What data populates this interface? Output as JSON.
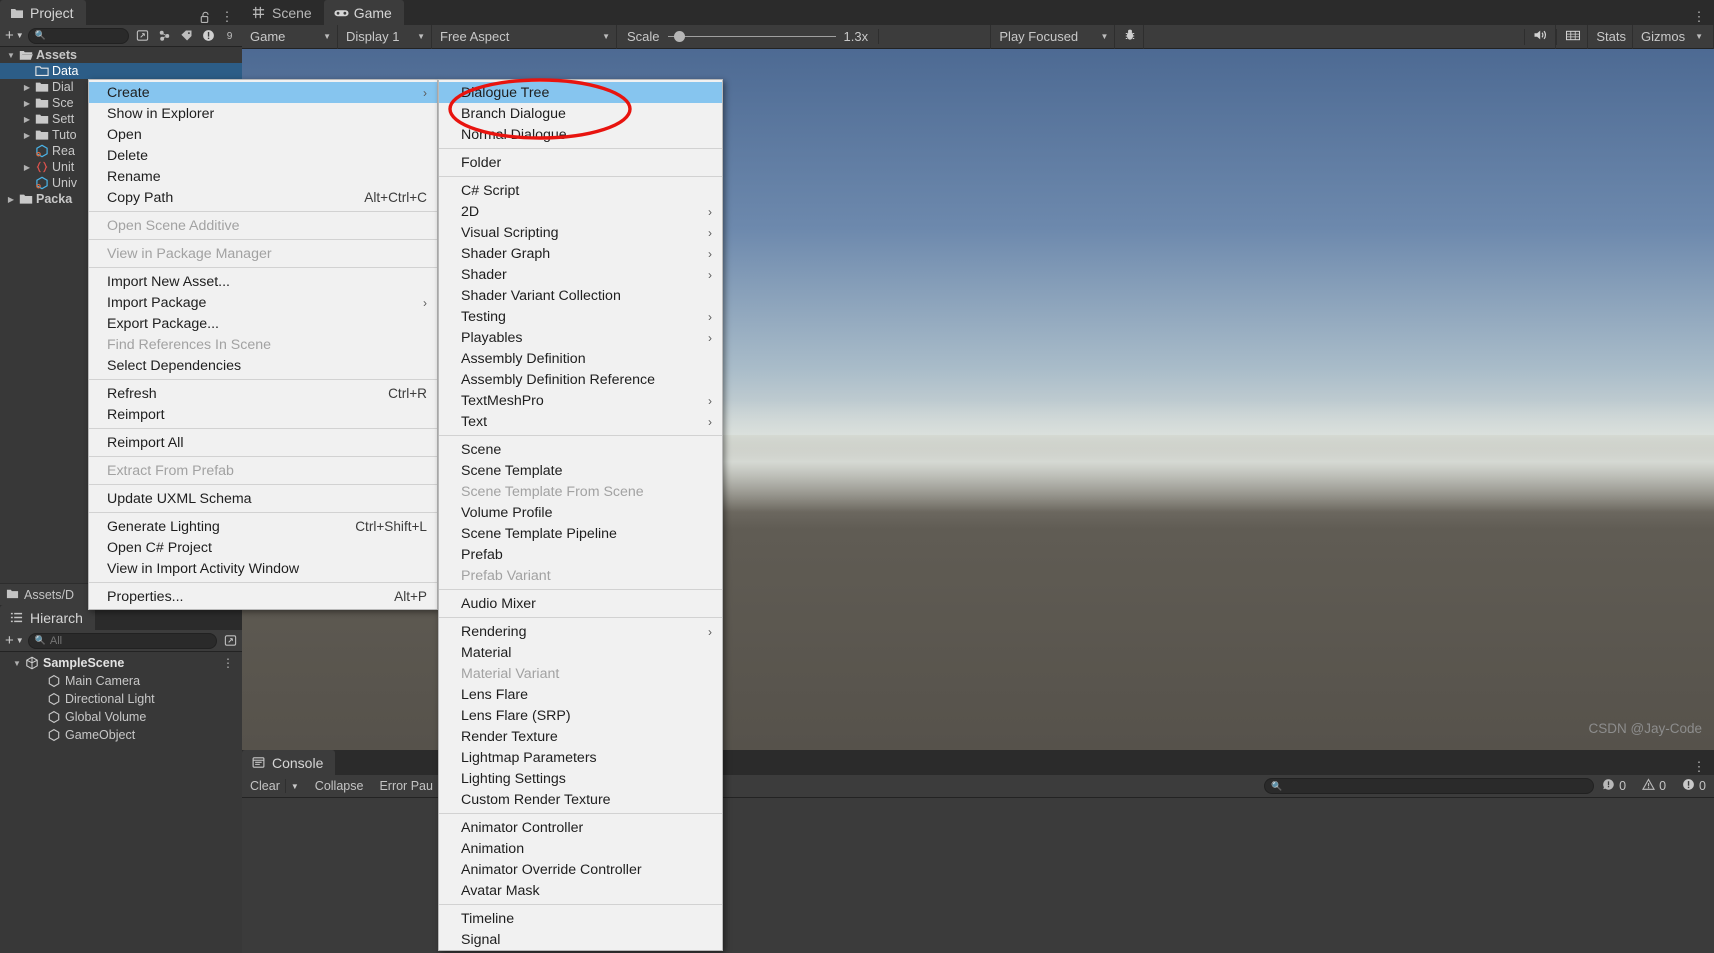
{
  "project_panel": {
    "tab_label": "Project",
    "tab_icon": "folder-icon",
    "lock_icon": "lock-open-icon",
    "kebab_icon": "more-vertical-icon",
    "toolbar": {
      "create_label": "+",
      "search_placeholder": "",
      "search_value": "",
      "search_icon": "search-icon",
      "icons": [
        "favorites-icon",
        "label-icon",
        "info-icon",
        "hidden-icon"
      ]
    },
    "tree": [
      {
        "label": "Assets",
        "icon": "open-folder-icon",
        "indent": 0,
        "twisty": "down",
        "selected": false,
        "bold": true
      },
      {
        "label": "Data",
        "icon": "folder-outline-icon",
        "indent": 1,
        "twisty": "none",
        "selected": true,
        "bold": false
      },
      {
        "label": "Dial",
        "icon": "folder-icon",
        "indent": 1,
        "twisty": "right",
        "selected": false,
        "bold": false
      },
      {
        "label": "Sce",
        "icon": "folder-icon",
        "indent": 1,
        "twisty": "right",
        "selected": false,
        "bold": false
      },
      {
        "label": "Sett",
        "icon": "folder-icon",
        "indent": 1,
        "twisty": "right",
        "selected": false,
        "bold": false
      },
      {
        "label": "Tuto",
        "icon": "folder-icon",
        "indent": 1,
        "twisty": "right",
        "selected": false,
        "bold": false
      },
      {
        "label": "Rea",
        "icon": "prefab-icon",
        "indent": 1,
        "twisty": "none",
        "selected": false,
        "bold": false
      },
      {
        "label": "Unit",
        "icon": "json-icon",
        "indent": 1,
        "twisty": "right",
        "selected": false,
        "bold": false
      },
      {
        "label": "Univ",
        "icon": "prefab-icon",
        "indent": 1,
        "twisty": "none",
        "selected": false,
        "bold": false
      },
      {
        "label": "Packa",
        "icon": "folder-icon",
        "indent": 0,
        "twisty": "right",
        "selected": false,
        "bold": true
      }
    ],
    "path_bar": {
      "label": "Assets/D",
      "icon": "folder-icon"
    }
  },
  "hierarchy_panel": {
    "tab_label": "Hierarch",
    "tab_icon": "hierarchy-icon",
    "toolbar": {
      "create_label": "+",
      "search_placeholder": "All",
      "search_icon": "search-icon"
    },
    "tree": [
      {
        "label": "SampleScene",
        "icon": "scene-icon",
        "indent": 0,
        "twisty": "down",
        "kebab": true
      },
      {
        "label": "Main Camera",
        "icon": "gameobject-icon",
        "indent": 1,
        "twisty": "none",
        "kebab": false
      },
      {
        "label": "Directional Light",
        "icon": "gameobject-icon",
        "indent": 1,
        "twisty": "none",
        "kebab": false
      },
      {
        "label": "Global Volume",
        "icon": "gameobject-icon",
        "indent": 1,
        "twisty": "none",
        "kebab": false
      },
      {
        "label": "GameObject",
        "icon": "gameobject-icon",
        "indent": 1,
        "twisty": "none",
        "kebab": false
      }
    ]
  },
  "game_panel": {
    "tabs": [
      {
        "label": "Scene",
        "icon": "scene-grid-icon",
        "active": false
      },
      {
        "label": "Game",
        "icon": "gamepad-icon",
        "active": true
      }
    ],
    "kebab_icon": "more-vertical-icon",
    "toolbar": {
      "target_display": "Game",
      "display": "Display 1",
      "aspect": "Free Aspect",
      "scale_label": "Scale",
      "scale_value": "1.3x",
      "scale_percent": 4,
      "play_mode": "Play Focused",
      "bug_icon": "bug-icon",
      "mute_icon": "mute-audio-icon",
      "grid_icon": "stats-grid-icon",
      "stats_label": "Stats",
      "gizmos_label": "Gizmos",
      "gizmos_caret": "chevron-down-icon"
    }
  },
  "console_panel": {
    "tab_label": "Console",
    "tab_icon": "console-icon",
    "toolbar": {
      "clear_label": "Clear",
      "clear_caret": "chevron-down-icon",
      "collapse_label": "Collapse",
      "error_pause_label": "Error Pau",
      "search_placeholder": "",
      "search_icon": "search-icon",
      "counts": [
        {
          "icon": "log-icon",
          "value": "0"
        },
        {
          "icon": "warning-icon",
          "value": "0"
        },
        {
          "icon": "error-icon",
          "value": "0"
        }
      ],
      "kebab_icon": "more-vertical-icon"
    }
  },
  "context_menu": {
    "items": [
      {
        "label": "Create",
        "shortcut": "",
        "submenu": true,
        "disabled": false,
        "highlight": true
      },
      {
        "label": "Show in Explorer",
        "shortcut": "",
        "submenu": false,
        "disabled": false,
        "highlight": false
      },
      {
        "label": "Open",
        "shortcut": "",
        "submenu": false,
        "disabled": false,
        "highlight": false
      },
      {
        "label": "Delete",
        "shortcut": "",
        "submenu": false,
        "disabled": false,
        "highlight": false
      },
      {
        "label": "Rename",
        "shortcut": "",
        "submenu": false,
        "disabled": false,
        "highlight": false
      },
      {
        "label": "Copy Path",
        "shortcut": "Alt+Ctrl+C",
        "submenu": false,
        "disabled": false,
        "highlight": false
      },
      {
        "separator": true
      },
      {
        "label": "Open Scene Additive",
        "shortcut": "",
        "submenu": false,
        "disabled": true,
        "highlight": false
      },
      {
        "separator": true
      },
      {
        "label": "View in Package Manager",
        "shortcut": "",
        "submenu": false,
        "disabled": true,
        "highlight": false
      },
      {
        "separator": true
      },
      {
        "label": "Import New Asset...",
        "shortcut": "",
        "submenu": false,
        "disabled": false,
        "highlight": false
      },
      {
        "label": "Import Package",
        "shortcut": "",
        "submenu": true,
        "disabled": false,
        "highlight": false
      },
      {
        "label": "Export Package...",
        "shortcut": "",
        "submenu": false,
        "disabled": false,
        "highlight": false
      },
      {
        "label": "Find References In Scene",
        "shortcut": "",
        "submenu": false,
        "disabled": true,
        "highlight": false
      },
      {
        "label": "Select Dependencies",
        "shortcut": "",
        "submenu": false,
        "disabled": false,
        "highlight": false
      },
      {
        "separator": true
      },
      {
        "label": "Refresh",
        "shortcut": "Ctrl+R",
        "submenu": false,
        "disabled": false,
        "highlight": false
      },
      {
        "label": "Reimport",
        "shortcut": "",
        "submenu": false,
        "disabled": false,
        "highlight": false
      },
      {
        "separator": true
      },
      {
        "label": "Reimport All",
        "shortcut": "",
        "submenu": false,
        "disabled": false,
        "highlight": false
      },
      {
        "separator": true
      },
      {
        "label": "Extract From Prefab",
        "shortcut": "",
        "submenu": false,
        "disabled": true,
        "highlight": false
      },
      {
        "separator": true
      },
      {
        "label": "Update UXML Schema",
        "shortcut": "",
        "submenu": false,
        "disabled": false,
        "highlight": false
      },
      {
        "separator": true
      },
      {
        "label": "Generate Lighting",
        "shortcut": "Ctrl+Shift+L",
        "submenu": false,
        "disabled": false,
        "highlight": false
      },
      {
        "label": "Open C# Project",
        "shortcut": "",
        "submenu": false,
        "disabled": false,
        "highlight": false
      },
      {
        "label": "View in Import Activity Window",
        "shortcut": "",
        "submenu": false,
        "disabled": false,
        "highlight": false
      },
      {
        "separator": true
      },
      {
        "label": "Properties...",
        "shortcut": "Alt+P",
        "submenu": false,
        "disabled": false,
        "highlight": false
      }
    ]
  },
  "create_submenu": {
    "items": [
      {
        "label": "Dialogue Tree",
        "submenu": false,
        "disabled": false,
        "highlight": true
      },
      {
        "label": "Branch Dialogue",
        "submenu": false,
        "disabled": false,
        "highlight": false
      },
      {
        "label": "Normal Dialogue",
        "submenu": false,
        "disabled": false,
        "highlight": false
      },
      {
        "separator": true
      },
      {
        "label": "Folder",
        "submenu": false,
        "disabled": false,
        "highlight": false
      },
      {
        "separator": true
      },
      {
        "label": "C# Script",
        "submenu": false,
        "disabled": false,
        "highlight": false
      },
      {
        "label": "2D",
        "submenu": true,
        "disabled": false,
        "highlight": false
      },
      {
        "label": "Visual Scripting",
        "submenu": true,
        "disabled": false,
        "highlight": false
      },
      {
        "label": "Shader Graph",
        "submenu": true,
        "disabled": false,
        "highlight": false
      },
      {
        "label": "Shader",
        "submenu": true,
        "disabled": false,
        "highlight": false
      },
      {
        "label": "Shader Variant Collection",
        "submenu": false,
        "disabled": false,
        "highlight": false
      },
      {
        "label": "Testing",
        "submenu": true,
        "disabled": false,
        "highlight": false
      },
      {
        "label": "Playables",
        "submenu": true,
        "disabled": false,
        "highlight": false
      },
      {
        "label": "Assembly Definition",
        "submenu": false,
        "disabled": false,
        "highlight": false
      },
      {
        "label": "Assembly Definition Reference",
        "submenu": false,
        "disabled": false,
        "highlight": false
      },
      {
        "label": "TextMeshPro",
        "submenu": true,
        "disabled": false,
        "highlight": false
      },
      {
        "label": "Text",
        "submenu": true,
        "disabled": false,
        "highlight": false
      },
      {
        "separator": true
      },
      {
        "label": "Scene",
        "submenu": false,
        "disabled": false,
        "highlight": false
      },
      {
        "label": "Scene Template",
        "submenu": false,
        "disabled": false,
        "highlight": false
      },
      {
        "label": "Scene Template From Scene",
        "submenu": false,
        "disabled": true,
        "highlight": false
      },
      {
        "label": "Volume Profile",
        "submenu": false,
        "disabled": false,
        "highlight": false
      },
      {
        "label": "Scene Template Pipeline",
        "submenu": false,
        "disabled": false,
        "highlight": false
      },
      {
        "label": "Prefab",
        "submenu": false,
        "disabled": false,
        "highlight": false
      },
      {
        "label": "Prefab Variant",
        "submenu": false,
        "disabled": true,
        "highlight": false
      },
      {
        "separator": true
      },
      {
        "label": "Audio Mixer",
        "submenu": false,
        "disabled": false,
        "highlight": false
      },
      {
        "separator": true
      },
      {
        "label": "Rendering",
        "submenu": true,
        "disabled": false,
        "highlight": false
      },
      {
        "label": "Material",
        "submenu": false,
        "disabled": false,
        "highlight": false
      },
      {
        "label": "Material Variant",
        "submenu": false,
        "disabled": true,
        "highlight": false
      },
      {
        "label": "Lens Flare",
        "submenu": false,
        "disabled": false,
        "highlight": false
      },
      {
        "label": "Lens Flare (SRP)",
        "submenu": false,
        "disabled": false,
        "highlight": false
      },
      {
        "label": "Render Texture",
        "submenu": false,
        "disabled": false,
        "highlight": false
      },
      {
        "label": "Lightmap Parameters",
        "submenu": false,
        "disabled": false,
        "highlight": false
      },
      {
        "label": "Lighting Settings",
        "submenu": false,
        "disabled": false,
        "highlight": false
      },
      {
        "label": "Custom Render Texture",
        "submenu": false,
        "disabled": false,
        "highlight": false
      },
      {
        "separator": true
      },
      {
        "label": "Animator Controller",
        "submenu": false,
        "disabled": false,
        "highlight": false
      },
      {
        "label": "Animation",
        "submenu": false,
        "disabled": false,
        "highlight": false
      },
      {
        "label": "Animator Override Controller",
        "submenu": false,
        "disabled": false,
        "highlight": false
      },
      {
        "label": "Avatar Mask",
        "submenu": false,
        "disabled": false,
        "highlight": false
      },
      {
        "separator": true
      },
      {
        "label": "Timeline",
        "submenu": false,
        "disabled": false,
        "highlight": false
      },
      {
        "label": "Signal",
        "submenu": false,
        "disabled": false,
        "highlight": false
      }
    ]
  },
  "annotation": {
    "shape": "red-ellipse",
    "color": "#e8140f"
  },
  "watermark": {
    "text": "CSDN @Jay-Code"
  },
  "colors": {
    "accent_selection": "#2c5d87",
    "menu_highlight": "#86c5ef",
    "panel_bg": "#383838",
    "toolbar_bg": "#3c3c3c",
    "tabbar_bg": "#2b2b2b",
    "menu_bg": "#f1f1f1",
    "annotation_red": "#e8140f"
  }
}
